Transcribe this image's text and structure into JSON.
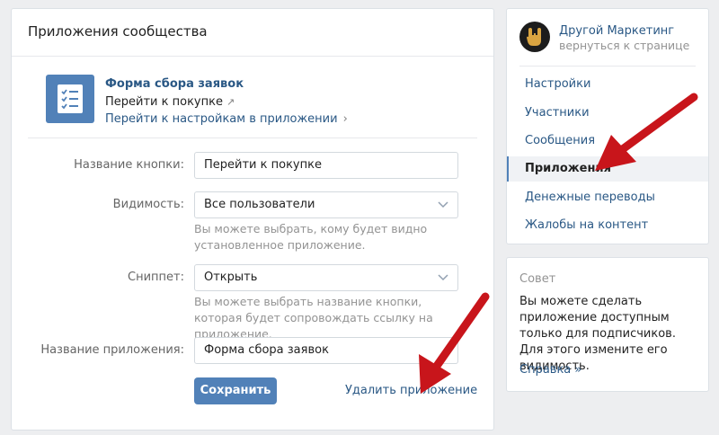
{
  "main": {
    "title": "Приложения сообщества",
    "app": {
      "name": "Форма сбора заявок",
      "link_buy": "Перейти к покупке",
      "link_settings": "Перейти к настройкам в приложении"
    },
    "form": {
      "button_name_label": "Название кнопки:",
      "button_name_value": "Перейти к покупке",
      "visibility_label": "Видимость:",
      "visibility_value": "Все пользователи",
      "visibility_hint": "Вы можете выбрать, кому будет видно установленное приложение.",
      "snippet_label": "Сниппет:",
      "snippet_value": "Открыть",
      "snippet_hint": "Вы можете выбрать название кнопки, которая будет сопровождать ссылку на приложение.",
      "app_name_label": "Название приложения:",
      "app_name_value": "Форма сбора заявок"
    },
    "save_label": "Сохранить",
    "delete_label": "Удалить приложение"
  },
  "sidebar": {
    "community_name": "Другой Маркетинг",
    "back_label": "вернуться к странице",
    "items": [
      {
        "label": "Настройки",
        "active": false
      },
      {
        "label": "Участники",
        "active": false
      },
      {
        "label": "Сообщения",
        "active": false
      },
      {
        "label": "Приложения",
        "active": true
      },
      {
        "label": "Денежные переводы",
        "active": false
      },
      {
        "label": "Жалобы на контент",
        "active": false
      }
    ]
  },
  "tip": {
    "title": "Совет",
    "text": "Вы можете сделать приложение доступным только для подписчиков. Для этого измените его видимость.",
    "link": "Справка »"
  },
  "colors": {
    "accent": "#5181b8",
    "link": "#2a5885",
    "annotation_arrow": "#c8151b"
  },
  "icons": {
    "app": "checklist-icon",
    "avatar": "rock-hand-icon",
    "external": "external-link-icon",
    "chevron_right": "chevron-right-icon",
    "dropdown": "chevron-down-icon"
  }
}
